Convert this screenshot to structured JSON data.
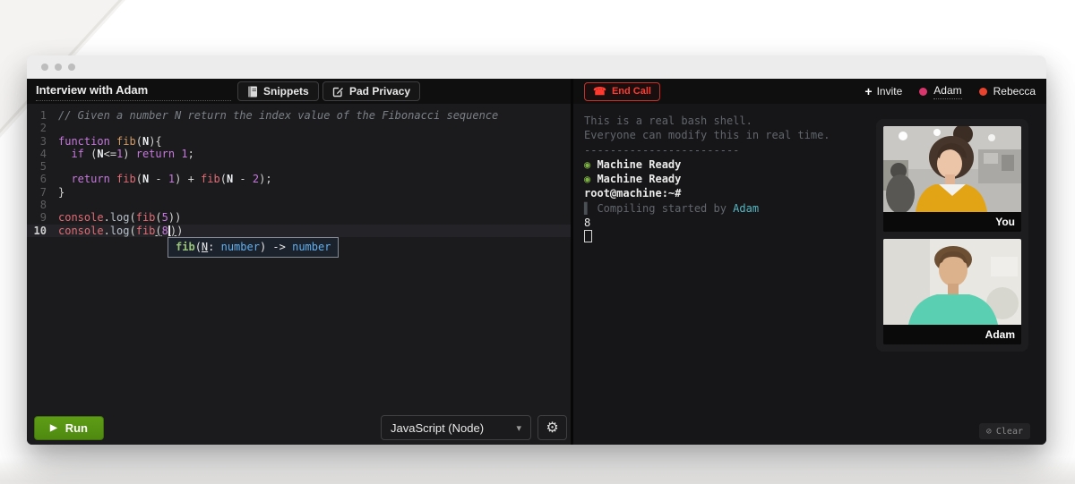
{
  "editor_header": {
    "title": "Interview with Adam",
    "snippets_label": "Snippets",
    "pad_privacy_label": "Pad Privacy"
  },
  "editor": {
    "active_line": 10,
    "lines": [
      [
        {
          "t": "// Given a number N return the index value of the Fibonacci sequence",
          "c": "com"
        }
      ],
      [],
      [
        {
          "t": "function ",
          "c": "kw"
        },
        {
          "t": "fib",
          "c": "fn"
        },
        {
          "t": "(",
          "c": "pun"
        },
        {
          "t": "N",
          "c": "var"
        },
        {
          "t": "){",
          "c": "pun"
        }
      ],
      [
        {
          "t": "  ",
          "c": "w"
        },
        {
          "t": "if",
          "c": "kw"
        },
        {
          "t": " (",
          "c": "pun"
        },
        {
          "t": "N",
          "c": "var"
        },
        {
          "t": "<=",
          "c": "op"
        },
        {
          "t": "1",
          "c": "num"
        },
        {
          "t": ") ",
          "c": "pun"
        },
        {
          "t": "return",
          "c": "kw"
        },
        {
          "t": " ",
          "c": "w"
        },
        {
          "t": "1",
          "c": "num"
        },
        {
          "t": ";",
          "c": "pun"
        }
      ],
      [],
      [
        {
          "t": "  ",
          "c": "w"
        },
        {
          "t": "return",
          "c": "kw"
        },
        {
          "t": " ",
          "c": "w"
        },
        {
          "t": "fib",
          "c": "call"
        },
        {
          "t": "(",
          "c": "pun"
        },
        {
          "t": "N",
          "c": "var"
        },
        {
          "t": " - ",
          "c": "op"
        },
        {
          "t": "1",
          "c": "num"
        },
        {
          "t": ")",
          "c": "pun"
        },
        {
          "t": " + ",
          "c": "op"
        },
        {
          "t": "fib",
          "c": "call"
        },
        {
          "t": "(",
          "c": "pun"
        },
        {
          "t": "N",
          "c": "var"
        },
        {
          "t": " - ",
          "c": "op"
        },
        {
          "t": "2",
          "c": "num"
        },
        {
          "t": ");",
          "c": "pun"
        }
      ],
      [
        {
          "t": "}",
          "c": "pun"
        }
      ],
      [],
      [
        {
          "t": "console",
          "c": "call"
        },
        {
          "t": ".",
          "c": "pun"
        },
        {
          "t": "log",
          "c": "prop"
        },
        {
          "t": "(",
          "c": "pun"
        },
        {
          "t": "fib",
          "c": "call"
        },
        {
          "t": "(",
          "c": "pun"
        },
        {
          "t": "5",
          "c": "num"
        },
        {
          "t": "))",
          "c": "pun"
        }
      ],
      [
        {
          "t": "console",
          "c": "call"
        },
        {
          "t": ".",
          "c": "pun"
        },
        {
          "t": "log",
          "c": "prop"
        },
        {
          "t": "(",
          "c": "pun"
        },
        {
          "t": "fib",
          "c": "call"
        },
        {
          "t": "(",
          "c": "punu"
        },
        {
          "t": "8",
          "c": "num"
        },
        {
          "t": "",
          "c": "caret"
        },
        {
          "t": ")",
          "c": "punu"
        },
        {
          "t": ")",
          "c": "pun"
        }
      ]
    ],
    "tooltip": [
      {
        "t": "fib",
        "c": "tg"
      },
      {
        "t": "(",
        "c": "tw"
      },
      {
        "t": "N",
        "c": "twu"
      },
      {
        "t": ": ",
        "c": "tw"
      },
      {
        "t": "number",
        "c": "tb"
      },
      {
        "t": ") ",
        "c": "tw"
      },
      {
        "t": "-> ",
        "c": "tw"
      },
      {
        "t": "number",
        "c": "tb"
      }
    ]
  },
  "runbar": {
    "run_label": "Run",
    "language": "JavaScript (Node)",
    "run_color": "#569211"
  },
  "call_header": {
    "end_call_label": "End Call",
    "end_call_color": "#ff3b30",
    "invite_label": "Invite",
    "participants": [
      {
        "name": "Adam",
        "color": "#d8366d"
      },
      {
        "name": "Rebecca",
        "color": "#e8432e"
      }
    ]
  },
  "terminal": {
    "clear_label": "Clear",
    "ready_color": "#7cb342",
    "user_color": "#56b6c2",
    "lines": [
      [
        {
          "t": "This is a real bash shell.",
          "c": "dim"
        }
      ],
      [
        {
          "t": "Everyone can modify this in real time.",
          "c": "dim"
        }
      ],
      [
        {
          "t": "------------------------",
          "c": "dim"
        }
      ],
      [
        {
          "t": "◉ ",
          "c": "green"
        },
        {
          "t": "Machine Ready",
          "c": "wb"
        }
      ],
      [
        {
          "t": "◉ ",
          "c": "green"
        },
        {
          "t": "Machine Ready",
          "c": "wb"
        }
      ],
      [
        {
          "t": "root@machine:~#",
          "c": "wb"
        }
      ],
      [
        {
          "t": "▌ ",
          "c": "dim2"
        },
        {
          "t": "Compiling started by ",
          "c": "dim"
        },
        {
          "t": "Adam",
          "c": "cyan"
        }
      ],
      [
        {
          "t": "8",
          "c": "out"
        }
      ],
      [
        {
          "t": "",
          "c": "cursor"
        }
      ]
    ]
  },
  "videos": [
    {
      "label": "You"
    },
    {
      "label": "Adam"
    }
  ]
}
